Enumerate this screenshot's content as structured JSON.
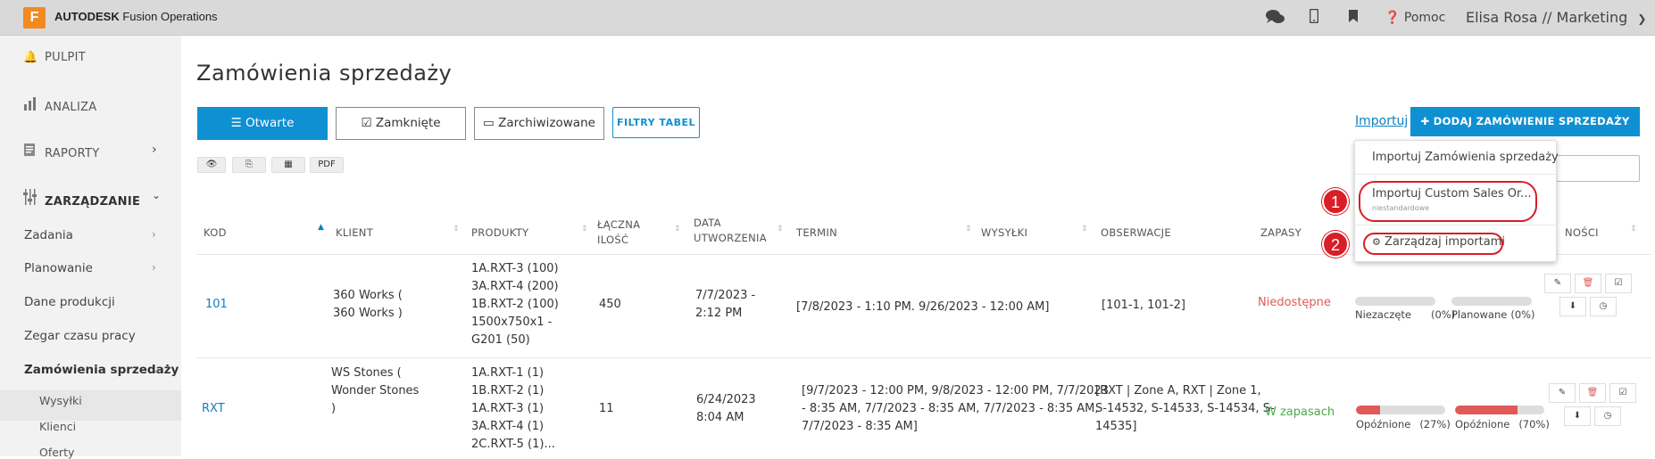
{
  "app": {
    "logo_letter": "F",
    "brand_bold": "AUTODESK",
    "brand_rest": " Fusion Operations"
  },
  "topbar": {
    "help": "Pomoc",
    "user": "Elisa Rosa // Marketing"
  },
  "sidebar": {
    "main": [
      {
        "label": "PULPIT",
        "icon": "bell-icon"
      },
      {
        "label": "ANALIZA",
        "icon": "bar-chart-icon"
      },
      {
        "label": "RAPORTY",
        "icon": "report-icon"
      },
      {
        "label": "ZARZĄDZANIE",
        "icon": "sliders-icon"
      }
    ],
    "sub": [
      "Zadania",
      "Planowanie",
      "Dane produkcji",
      "Zegar czasu pracy",
      "Zamówienia sprzedaży"
    ],
    "sub2": [
      "Wysyłki",
      "Klienci",
      "Oferty"
    ]
  },
  "page": {
    "title": "Zamówienia sprzedaży"
  },
  "tabs": {
    "open": "Otwarte",
    "closed": "Zamknięte",
    "archived": "Zarchiwizowane",
    "filters": "FILTRY TABEL"
  },
  "tools": {
    "pdf": "PDF"
  },
  "actions": {
    "import": "Importuj",
    "add": "DODAJ ZAMÓWIENIE SPRZEDAŻY"
  },
  "dropdown": {
    "item1": "Importuj Zamówienia sprzedaży",
    "item2": "Importuj Custom Sales Or...",
    "item2_sub": "niestandardowe",
    "item3": "Zarządzaj importami",
    "badge1": "1",
    "badge2": "2"
  },
  "table": {
    "headers": {
      "kod": "KOD",
      "klient": "KLIENT",
      "produkty": "PRODUKTY",
      "ilosc1": "ŁĄCZNA",
      "ilosc2": "ILOŚĆ",
      "data1": "DATA",
      "data2": "UTWORZENIA",
      "termin": "TERMIN",
      "wysylki": "WYSYŁKI",
      "obserwacje": "OBSERWACJE",
      "zapasy": "ZAPASY",
      "nosci": "NOŚCI"
    },
    "rows": [
      {
        "kod": "101",
        "klient": "360 Works (\n360 Works )",
        "produkty": "1A.RXT-3 (100)\n3A.RXT-4 (200)\n1B.RXT-2 (100)\n1500x750x1 -\nG201 (50)",
        "ilosc": "450",
        "data": "7/7/2023 -\n2:12 PM",
        "termin": "[7/8/2023 - 1:10 PM. 9/26/2023 - 12:00 AM]",
        "obserwacje": "[101-1, 101-2]",
        "zapasy": "Niedostępne",
        "p1_label": "Niezaczęte",
        "p1_pct": "(0%)",
        "p1_value": 0,
        "p2_label": "Planowane",
        "p2_pct": "(0%)",
        "p2_value": 0
      },
      {
        "kod": "RXT",
        "klient": "WS Stones (\nWonder Stones\n)",
        "produkty": "1A.RXT-1 (1)\n1B.RXT-2 (1)\n1A.RXT-3 (1)\n3A.RXT-4 (1)\n2C.RXT-5 (1)...",
        "ilosc": "11",
        "data": "6/24/2023\n8:04 AM",
        "termin": "[9/7/2023 - 12:00 PM, 9/8/2023 - 12:00 PM, 7/7/2023\n- 8:35 AM, 7/7/2023 - 8:35 AM, 7/7/2023 - 8:35 AM,\n7/7/2023 - 8:35 AM]",
        "obserwacje": "[RXT | Zone A, RXT | Zone 1,\nS-14532, S-14533, S-14534, S-\n14535]",
        "zapasy": "W zapasach",
        "p1_label": "Opóźnione",
        "p1_pct": "(27%)",
        "p1_value": 27,
        "p2_label": "Opóźnione",
        "p2_pct": "(70%)",
        "p2_value": 70
      }
    ]
  }
}
